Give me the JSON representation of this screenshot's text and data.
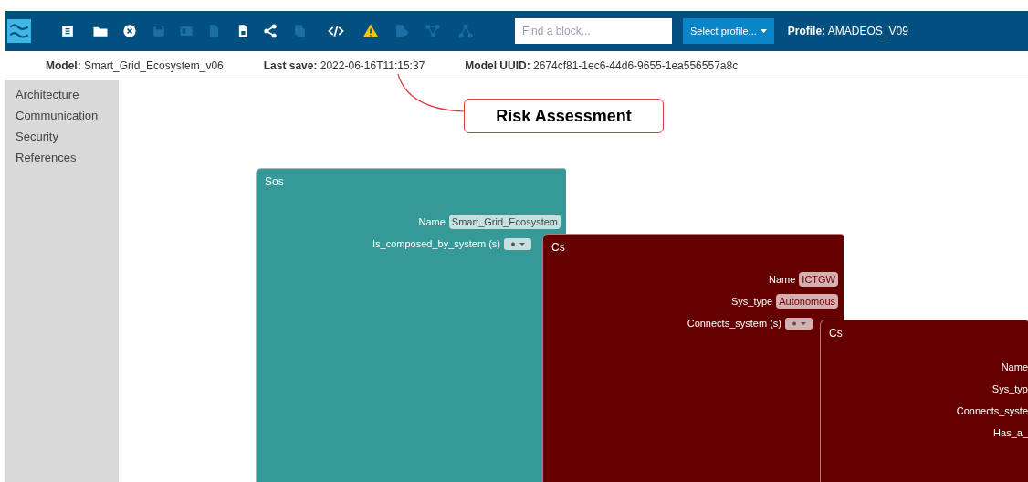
{
  "toolbar": {
    "buttons": [
      {
        "disabled": false
      },
      {
        "disabled": false
      },
      {
        "disabled": false
      },
      {
        "disabled": true
      },
      {
        "disabled": true
      },
      {
        "disabled": true
      },
      {
        "disabled": false
      },
      {
        "disabled": false
      },
      {
        "disabled": true
      },
      {
        "disabled": false
      },
      {
        "disabled": false
      },
      {
        "disabled": true
      },
      {
        "disabled": true
      },
      {
        "disabled": true
      }
    ],
    "search": {
      "placeholder": "Find a block..."
    },
    "profile_button": "Select profile...",
    "profile": "**Profile:** AMADEOS_V09"
  },
  "info_bar": [
    "**Model:** Smart_Grid_Ecosystem_v06",
    "**Last save:** 2022-06-16T11:15:37",
    "**Model UUID:** 2674cf81-1ec6-44d6-9655-1ea556557a8c"
  ],
  "sidebar": {
    "items": [
      "Architecture",
      "Communication",
      "Security",
      "References"
    ]
  },
  "annotation": {
    "text": "Risk Assessment"
  },
  "canvas": {
    "blocks": [
      {
        "title": "Sos",
        "color": "#359a97",
        "fields": [
          {
            "kind": "value",
            "label": "Name",
            "value": "Smart_Grid_Ecosystem"
          },
          {
            "kind": "list",
            "label": "Is_composed_by_system (s)",
            "children": [
              {
                "title": "Cs",
                "color": "#650000",
                "fields": [
                  {
                    "kind": "value",
                    "label": "Name",
                    "value": "ICTGW"
                  },
                  {
                    "kind": "value",
                    "label": "Sys_type",
                    "value": "Autonomous"
                  },
                  {
                    "kind": "list",
                    "label": "Connects_system (s)",
                    "children": [
                      {
                        "title": "Cs",
                        "color": "#650000",
                        "fields": [
                          {
                            "label": "Name"
                          },
                          {
                            "label": "Sys_typ"
                          },
                          {
                            "label": "Connects_syste"
                          },
                          {
                            "label": "Has_a_"
                          }
                        ]
                      }
                    ]
                  }
                ]
              }
            ]
          }
        ]
      }
    ]
  }
}
